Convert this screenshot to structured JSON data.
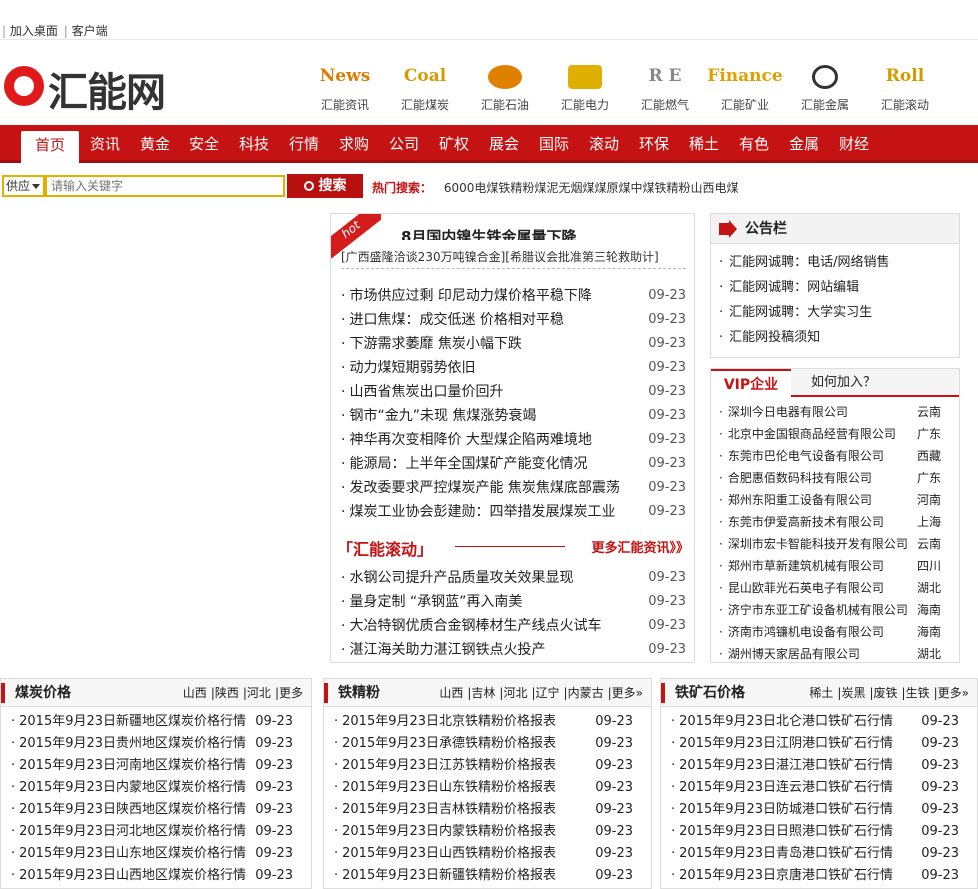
{
  "topbar": {
    "add_desktop": "加入桌面",
    "client": "客户端"
  },
  "logo": {
    "text": "汇能网"
  },
  "channels": [
    {
      "icon": "news-icon",
      "logo_text": "News",
      "label": "汇能资讯",
      "color": "#e07a00"
    },
    {
      "icon": "coal-icon",
      "logo_text": "Coal",
      "label": "汇能煤炭",
      "color": "#d49a00"
    },
    {
      "icon": "oil-icon",
      "logo_text": "",
      "label": "汇能石油",
      "color": "#e08000"
    },
    {
      "icon": "power-icon",
      "logo_text": "",
      "label": "汇能电力",
      "color": "#e0b000"
    },
    {
      "icon": "gas-icon",
      "logo_text": "R E",
      "label": "汇能燃气",
      "color": "#888888"
    },
    {
      "icon": "mining-icon",
      "logo_text": "Finance",
      "label": "汇能矿业",
      "color": "#e0a000"
    },
    {
      "icon": "metal-icon",
      "logo_text": "",
      "label": "汇能金属",
      "color": "#333333"
    },
    {
      "icon": "roll-icon",
      "logo_text": "Roll",
      "label": "汇能滚动",
      "color": "#d49a00"
    }
  ],
  "nav": [
    "首页",
    "资讯",
    "黄金",
    "安全",
    "科技",
    "行情",
    "求购",
    "公司",
    "矿权",
    "展会",
    "国际",
    "滚动",
    "环保",
    "稀土",
    "有色",
    "金属",
    "财经"
  ],
  "search": {
    "select_value": "供应",
    "placeholder": "请输入关键字",
    "button": "搜索",
    "hot_title": "热门搜索：",
    "hot_terms": [
      "6000",
      "电煤",
      "铁精粉",
      "煤泥",
      "无烟煤",
      "煤",
      "原煤",
      "中煤",
      "铁精粉",
      "山西电煤"
    ]
  },
  "news": {
    "badge": "hot",
    "headline": "8月国内镍生铁金属量下降",
    "sublinks": [
      "[广西盛隆洽谈230万吨镍合金]",
      "[希腊议会批准第三轮救助计]"
    ],
    "items": [
      {
        "title": "市场供应过剩 印尼动力煤价格平稳下降",
        "date": "09-23"
      },
      {
        "title": "进口焦煤：成交低迷 价格相对平稳",
        "date": "09-23"
      },
      {
        "title": "下游需求萎靡 焦炭小幅下跌",
        "date": "09-23"
      },
      {
        "title": "动力煤短期弱势依旧",
        "date": "09-23"
      },
      {
        "title": "山西省焦炭出口量价回升",
        "date": "09-23"
      },
      {
        "title": "钢市“金九”未现 焦煤涨势衰竭",
        "date": "09-23"
      },
      {
        "title": "神华再次变相降价 大型煤企陷两难境地",
        "date": "09-23"
      },
      {
        "title": "能源局：上半年全国煤矿产能变化情况",
        "date": "09-23"
      },
      {
        "title": "发改委要求严控煤炭产能 焦炭焦煤底部震荡",
        "date": "09-23"
      },
      {
        "title": "煤炭工业协会彭建勋：四举措发展煤炭工业",
        "date": "09-23"
      }
    ],
    "roll_title": "「汇能滚动」",
    "roll_more": "更多汇能资讯》》",
    "roll_items": [
      {
        "title": "水钢公司提升产品质量攻关效果显现",
        "date": "09-23"
      },
      {
        "title": "量身定制 “承钢蓝”再入南美",
        "date": "09-23"
      },
      {
        "title": "大冶特钢优质合金钢棒材生产线点火试车",
        "date": "09-23"
      },
      {
        "title": "湛江海关助力湛江钢铁点火投产",
        "date": "09-23"
      }
    ]
  },
  "notice": {
    "title": "公告栏",
    "items": [
      "汇能网诚聘：电话/网络销售",
      "汇能网诚聘：网站编辑",
      "汇能网诚聘：大学实习生",
      "汇能网投稿须知"
    ]
  },
  "vip": {
    "tab1": "VIP企业",
    "tab2": "如何加入？",
    "items": [
      {
        "name": "深圳今日电器有限公司",
        "region": "云南"
      },
      {
        "name": "北京中金国银商品经营有限公司",
        "region": "广东"
      },
      {
        "name": "东莞市巴伦电气设备有限公司",
        "region": "西藏"
      },
      {
        "name": "合肥惠佰数码科技有限公司",
        "region": "广东"
      },
      {
        "name": "郑州东阳重工设备有限公司",
        "region": "河南"
      },
      {
        "name": "东莞市伊爱高新技术有限公司",
        "region": "上海"
      },
      {
        "name": "深圳市宏卡智能科技开发有限公司",
        "region": "云南"
      },
      {
        "name": "郑州市草新建筑机械有限公司",
        "region": "四川"
      },
      {
        "name": "昆山欧菲光石英电子有限公司",
        "region": "湖北"
      },
      {
        "name": "济宁市东亚工矿设备机械有限公司",
        "region": "海南"
      },
      {
        "name": "济南市鸿镰机电设备有限公司",
        "region": "海南"
      },
      {
        "name": "湖州博天家居品有限公司",
        "region": "湖北"
      }
    ]
  },
  "boxes": [
    {
      "title": "煤炭价格",
      "links": [
        "山西",
        "|",
        "陕西",
        "|",
        "河北",
        "|",
        "更多"
      ],
      "items": [
        {
          "title": "2015年9月23日新疆地区煤炭价格行情",
          "date": "09-23"
        },
        {
          "title": "2015年9月23日贵州地区煤炭价格行情",
          "date": "09-23"
        },
        {
          "title": "2015年9月23日河南地区煤炭价格行情",
          "date": "09-23"
        },
        {
          "title": "2015年9月23日内蒙地区煤炭价格行情",
          "date": "09-23"
        },
        {
          "title": "2015年9月23日陕西地区煤炭价格行情",
          "date": "09-23"
        },
        {
          "title": "2015年9月23日河北地区煤炭价格行情",
          "date": "09-23"
        },
        {
          "title": "2015年9月23日山东地区煤炭价格行情",
          "date": "09-23"
        },
        {
          "title": "2015年9月23日山西地区煤炭价格行情",
          "date": "09-23"
        }
      ]
    },
    {
      "title": "铁精粉",
      "links": [
        "山西",
        "|",
        "吉林",
        "|",
        "河北",
        "|",
        "辽宁",
        "|",
        "内蒙古",
        "|",
        "更多»"
      ],
      "items": [
        {
          "title": "2015年9月23日北京铁精粉价格报表",
          "date": "09-23"
        },
        {
          "title": "2015年9月23日承德铁精粉价格报表",
          "date": "09-23"
        },
        {
          "title": "2015年9月23日江苏铁精粉价格报表",
          "date": "09-23"
        },
        {
          "title": "2015年9月23日山东铁精粉价格报表",
          "date": "09-23"
        },
        {
          "title": "2015年9月23日吉林铁精粉价格报表",
          "date": "09-23"
        },
        {
          "title": "2015年9月23日内蒙铁精粉价格报表",
          "date": "09-23"
        },
        {
          "title": "2015年9月23日山西铁精粉价格报表",
          "date": "09-23"
        },
        {
          "title": "2015年9月23日新疆铁精粉价格报表",
          "date": "09-23"
        }
      ]
    },
    {
      "title": "铁矿石价格",
      "links": [
        "稀土",
        "|",
        "炭黑",
        "|",
        "废铁",
        "|",
        "生铁",
        "|",
        "更多»"
      ],
      "items": [
        {
          "title": "2015年9月23日北仑港口铁矿石行情",
          "date": "09-23"
        },
        {
          "title": "2015年9月23日江阴港口铁矿石行情",
          "date": "09-23"
        },
        {
          "title": "2015年9月23日湛江港口铁矿石行情",
          "date": "09-23"
        },
        {
          "title": "2015年9月23日连云港口铁矿石行情",
          "date": "09-23"
        },
        {
          "title": "2015年9月23日防城港口铁矿石行情",
          "date": "09-23"
        },
        {
          "title": "2015年9月23日日照港口铁矿石行情",
          "date": "09-23"
        },
        {
          "title": "2015年9月23日青岛港口铁矿石行情",
          "date": "09-23"
        },
        {
          "title": "2015年9月23日京唐港口铁矿石行情",
          "date": "09-23"
        }
      ]
    }
  ]
}
